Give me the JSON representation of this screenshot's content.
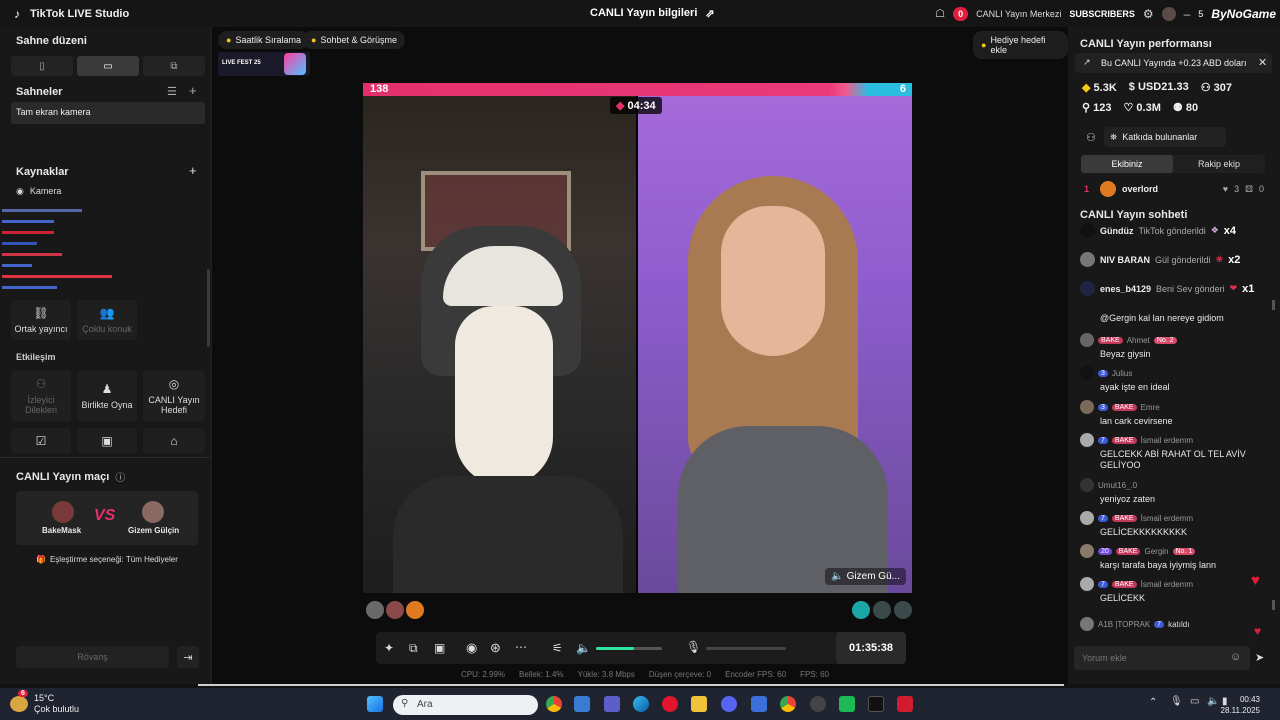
{
  "titlebar": {
    "app_name": "TikTok LIVE Studio",
    "center_title": "CANLI Yayın bilgileri",
    "notif_count": "0",
    "live_center_label": "CANLI Yayın Merkezi",
    "subscribers_label": "SUBSCRIBERS",
    "right_count": "5",
    "watermark": "ByNoGame"
  },
  "left": {
    "scene_layout_title": "Sahne düzeni",
    "scenes_title": "Sahneler",
    "scene_items": [
      "Tam ekran kamera"
    ],
    "sources_title": "Kaynaklar",
    "source_items": [
      "Kamera"
    ],
    "collab": [
      {
        "label": "Ortak yayıncı",
        "icon": "link-icon",
        "enabled": true
      },
      {
        "label": "Çoklu konuk",
        "icon": "users-icon",
        "enabled": false
      }
    ],
    "interaction_title": "Etkileşim",
    "interaction_tiles": [
      {
        "label": "İzleyici Dilekleri",
        "icon": "user-wish-icon",
        "enabled": false
      },
      {
        "label": "Birlikte Oyna",
        "icon": "joystick-icon",
        "enabled": true
      },
      {
        "label": "CANLI Yayın Hedefi",
        "icon": "target-icon",
        "enabled": true
      }
    ],
    "match_title": "CANLI Yayın maçı",
    "match_player1": "BakeMask",
    "match_player2": "Gizem Gülçin",
    "match_vs": "VS",
    "match_option": "Eşleştirme seçeneği: Tüm Hediyeler",
    "rematch_label": "Rövanş"
  },
  "stage": {
    "chip_hourly": "Saatlik Sıralama",
    "chip_chat": "Sohbet & Görüşme",
    "chip_gift_goal": "Hediye hedefi ekle",
    "fest_label": "LIVE FEST 25",
    "score_left": "138",
    "score_right": "6",
    "match_timer": "04:34",
    "opponent_name": "Gizem Gü...",
    "elapsed": "01:35:38"
  },
  "stats": {
    "cpu": "CPU: 2.99%",
    "memory": "Bellek: 1.4%",
    "upload": "Yükle: 3.8 Mbps",
    "dropped": "Düşen çerçeve: 0",
    "encoder_fps": "Encoder FPS: 60",
    "fps": "FPS: 60"
  },
  "right": {
    "perf_title": "CANLI Yayın performansı",
    "perf_note": "Bu CANLI Yayında +0.23 ABD doları",
    "stat_diamonds": "5.3K",
    "stat_usd": "USD21.33",
    "stat_viewers": "307",
    "stat_new": "123",
    "stat_likes": "0.3M",
    "stat_gifters": "80",
    "contributors_label": "Katkıda bulunanlar",
    "tab_us": "Ekibiniz",
    "tab_rival": "Rakip ekip",
    "top_rank": "1",
    "top_name": "overlord",
    "top_hearts": "3",
    "top_gifts": "0",
    "chat_title": "CANLI Yayın sohbeti",
    "gifts": [
      {
        "user": "Gündüz",
        "text": "TikTok gönderildi",
        "count": "x4"
      },
      {
        "user": "NIV BARAN",
        "text": "Gül gönderildi",
        "count": "x2"
      },
      {
        "user": "enes_b4129",
        "text": "Beni Sev gönderi",
        "count": "x1"
      }
    ],
    "messages": [
      {
        "user": "",
        "badges": "",
        "text": "@Gergin kal lan nereye gidiom"
      },
      {
        "user": "Ahmet",
        "level": "",
        "fan": "BAKE",
        "no": "No. 2",
        "text": "Beyaz giysin"
      },
      {
        "user": "Julius",
        "level": "3",
        "fan": "",
        "no": "",
        "text": "ayak işte en ideal"
      },
      {
        "user": "Emre",
        "level": "3",
        "fan": "BAKE",
        "no": "",
        "text": "lan cark cevirsene"
      },
      {
        "user": "İsmail erdemm",
        "level": "7",
        "fan": "BAKE",
        "no": "",
        "text": "GELCEKK ABİ RAHAT OL TEL AVİV GELİYOO"
      },
      {
        "user": "Umut16_.0",
        "level": "",
        "fan": "",
        "no": "",
        "text": "yeniyoz zaten"
      },
      {
        "user": "İsmail erdemm",
        "level": "7",
        "fan": "BAKE",
        "no": "",
        "text": "GELİCEKKKKKKKKK"
      },
      {
        "user": "Gergin",
        "level": "20",
        "fan": "BAKE",
        "no": "No. 1",
        "text": "karşı tarafa baya iyiymiş lann"
      },
      {
        "user": "İsmail erdemm",
        "level": "7",
        "fan": "BAKE",
        "no": "",
        "text": "GELİCEKK"
      }
    ],
    "join_user": "A1B |TOPRAK",
    "join_level": "7",
    "join_text": "katıldı",
    "comment_placeholder": "Yorum ekle"
  },
  "taskbar": {
    "temp": "15°C",
    "weather": "Çok bulutlu",
    "weather_badge": "6",
    "search_placeholder": "Ara",
    "time": "00:43",
    "date": "28.11.2025"
  },
  "colors": {
    "accent_pink": "#e3306c",
    "accent_cyan": "#2bbde0",
    "red_badge": "#e0203a"
  }
}
